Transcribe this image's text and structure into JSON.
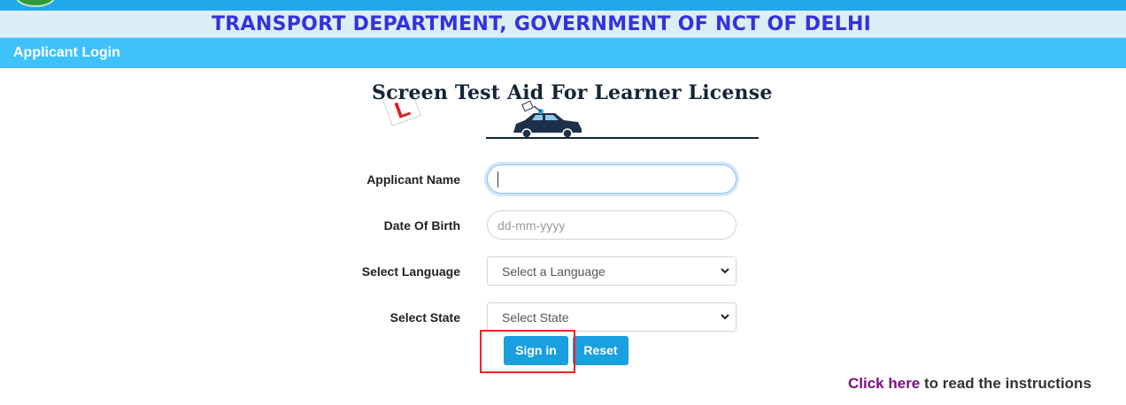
{
  "header": {
    "department_title": "TRANSPORT DEPARTMENT, GOVERNMENT OF NCT OF DELHI",
    "section_title": "Applicant Login"
  },
  "banner": {
    "title": "Screen Test Aid For Learner License",
    "badge_letter": "L"
  },
  "form": {
    "applicant_name": {
      "label": "Applicant Name",
      "value": ""
    },
    "date_of_birth": {
      "label": "Date Of Birth",
      "placeholder": "dd-mm-yyyy"
    },
    "language": {
      "label": "Select Language",
      "selected": "Select a Language"
    },
    "state": {
      "label": "Select State",
      "selected": "Select State"
    }
  },
  "buttons": {
    "sign_in": "Sign in",
    "reset": "Reset"
  },
  "instructions": {
    "link_text": "Click here",
    "rest_text": " to read the instructions"
  },
  "colors": {
    "header_blue": "#21a9e8",
    "login_bar": "#3fc1f9",
    "title_blue": "#3432dd",
    "button_blue": "#1a9fe0",
    "highlight_red": "#ef2525",
    "link_purple": "#7a0d7c"
  }
}
